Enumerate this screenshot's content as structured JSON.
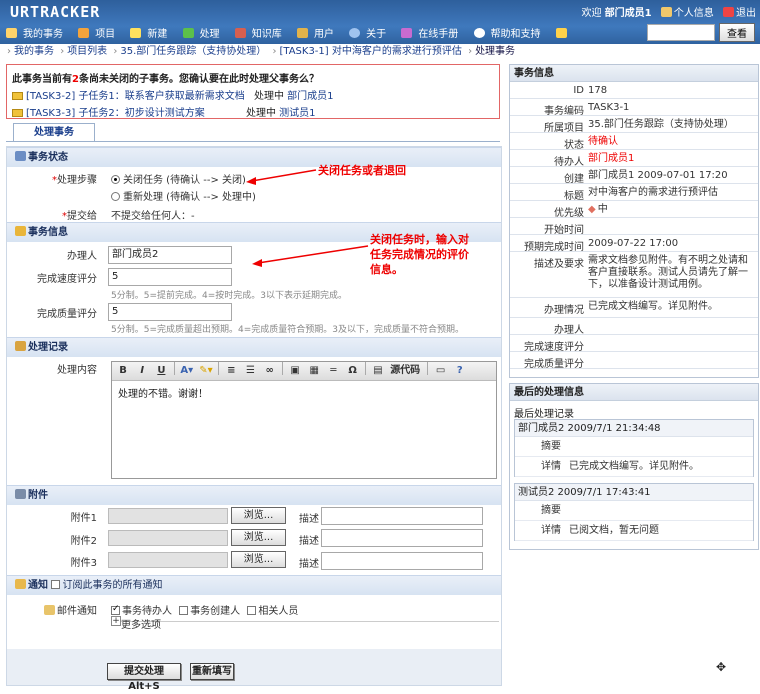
{
  "app": {
    "logo": "URTRACKER"
  },
  "usernav": {
    "welcome": "欢迎",
    "user": "部门成员1",
    "profile": "个人信息",
    "logout": "退出"
  },
  "menu": [
    "我的事务",
    "项目",
    "新建",
    "处理",
    "知识库",
    "用户",
    "关于",
    "在线手册",
    "帮助和支持"
  ],
  "search": {
    "button": "查看"
  },
  "breadcrumb": [
    "我的事务",
    "项目列表",
    "35.部门任务跟踪（支持协处理）",
    "[TASK3-1] 对中海客户的需求进行预评估",
    "处理事务"
  ],
  "warning": {
    "title_a": "此事务当前有",
    "count": "2",
    "title_b": "条尚未关闭的子事务。您确认要在此时处理父事务么？",
    "items": [
      {
        "link": "[TASK3-2] 子任务1：联系客户获取最新需求文档",
        "status": "处理中",
        "owner": "部门成员1"
      },
      {
        "link": "[TASK3-3] 子任务2：初步设计测试方案",
        "status": "处理中",
        "owner": "测试员1"
      }
    ]
  },
  "tab": "处理事务",
  "status_section": {
    "title": "事务状态",
    "step_label": "处理步骤",
    "options": [
      "关闭任务 (待确认 --> 关闭)",
      "重新处理 (待确认 --> 处理中)"
    ],
    "submit_to_label": "提交给",
    "submit_to_value": "不提交给任何人：-"
  },
  "info_section": {
    "title": "事务信息",
    "handler_label": "办理人",
    "handler_value": "部门成员2",
    "speed_label": "完成速度评分",
    "speed_value": "5",
    "speed_hint": "5分制。5=提前完成。4=按时完成。3以下表示延期完成。",
    "quality_label": "完成质量评分",
    "quality_value": "5",
    "quality_hint": "5分制。5=完成质量超出预期。4=完成质量符合预期。3及以下，完成质量不符合预期。"
  },
  "record_section": {
    "title": "处理记录",
    "content_label": "处理内容",
    "source_label": "源代码",
    "text": "处理的不错。谢谢！"
  },
  "attach_section": {
    "title": "附件",
    "files": [
      "附件1",
      "附件2",
      "附件3"
    ],
    "browse": "浏览...",
    "desc": "描述"
  },
  "notify_section": {
    "title": "通知",
    "subscribe": "订阅此事务的所有通知",
    "mail_label": "邮件通知",
    "targets": [
      "事务待办人",
      "事务创建人",
      "相关人员"
    ],
    "more": "更多选项"
  },
  "buttons": {
    "submit": "提交处理 Alt+S",
    "reset": "重新填写"
  },
  "annotations": {
    "a1": "关闭任务或者退回",
    "a2": [
      "关闭任务时，输入对",
      "任务完成情况的评价",
      "信息。"
    ]
  },
  "task_info": {
    "title": "事务信息",
    "rows": [
      {
        "k": "ID",
        "v": "178"
      },
      {
        "k": "事务编码",
        "v": "TASK3-1"
      },
      {
        "k": "所属项目",
        "v": "35.部门任务跟踪（支持协处理）"
      },
      {
        "k": "状态",
        "v": "待确认"
      },
      {
        "k": "待办人",
        "v": "部门成员1"
      },
      {
        "k": "创建",
        "v": "部门成员1 2009-07-01 17:20"
      },
      {
        "k": "标题",
        "v": "对中海客户的需求进行预评估"
      },
      {
        "k": "优先级",
        "v": "中"
      },
      {
        "k": "开始时间",
        "v": ""
      },
      {
        "k": "预期完成时间",
        "v": "2009-07-22 17:00"
      },
      {
        "k": "描述及要求",
        "v": "需求文档参见附件。有不明之处请和客户直接联系。测试人员请先了解一下，以准备设计测试用例。"
      },
      {
        "k": "办理情况",
        "v": "已完成文档编写。详见附件。"
      },
      {
        "k": "办理人",
        "v": ""
      },
      {
        "k": "完成速度评分",
        "v": ""
      },
      {
        "k": "完成质量评分",
        "v": ""
      }
    ]
  },
  "last_process": {
    "title": "最后的处理信息",
    "subtitle": "最后处理记录",
    "records": [
      {
        "head": "部门成员2 2009/7/1 21:34:48",
        "summary_label": "摘要",
        "summary": "",
        "detail_label": "详情",
        "detail": "已完成文档编写。详见附件。"
      },
      {
        "head": "测试员2 2009/7/1 17:43:41",
        "summary_label": "摘要",
        "summary": "",
        "detail_label": "详情",
        "detail": "已阅文档，暂无问题"
      }
    ]
  },
  "colors": {
    "topbar": "#3f79bd",
    "red": "#e00000",
    "link": "#1a3e8c"
  }
}
